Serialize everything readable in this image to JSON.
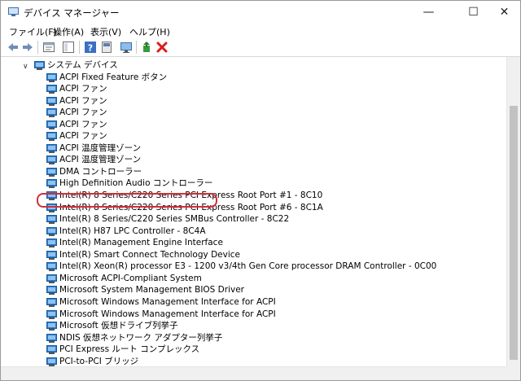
{
  "window": {
    "title": "デバイス マネージャー",
    "minimize_glyph": "—",
    "maximize_glyph": "☐",
    "close_glyph": "✕"
  },
  "menu": [
    {
      "label": "ファイル(F)"
    },
    {
      "label": "操作(A)"
    },
    {
      "label": "表示(V)"
    },
    {
      "label": "ヘルプ(H)"
    }
  ],
  "toolbar_icons": [
    "back-arrow-icon",
    "forward-arrow-icon",
    "properties-icon",
    "show-hide-console-tree-icon",
    "help-icon",
    "help-book-icon",
    "monitor-icon",
    "add-driver-icon",
    "uninstall-x-icon"
  ],
  "tree": {
    "category_label": "システム デバイス",
    "expanded": true,
    "items": [
      {
        "label": "ACPI Fixed Feature ボタン"
      },
      {
        "label": "ACPI ファン"
      },
      {
        "label": "ACPI ファン"
      },
      {
        "label": "ACPI ファン"
      },
      {
        "label": "ACPI ファン"
      },
      {
        "label": "ACPI ファン"
      },
      {
        "label": "ACPI 温度管理ゾーン"
      },
      {
        "label": "ACPI 温度管理ゾーン"
      },
      {
        "label": "DMA コントローラー"
      },
      {
        "label": "High Definition Audio コントローラー"
      },
      {
        "label": "Intel(R) 8 Series/C220 Series PCI Express Root Port #1 - 8C10"
      },
      {
        "label": "Intel(R) 8 Series/C220 Series PCI Express Root Port #6 - 8C1A"
      },
      {
        "label": "Intel(R) 8 Series/C220 Series SMBus Controller - 8C22"
      },
      {
        "label": "Intel(R) H87 LPC Controller - 8C4A"
      },
      {
        "label": "Intel(R) Management Engine Interface"
      },
      {
        "label": "Intel(R) Smart Connect Technology Device",
        "highlighted": true
      },
      {
        "label": "Intel(R) Xeon(R) processor E3 - 1200 v3/4th Gen Core processor DRAM Controller - 0C00"
      },
      {
        "label": "Microsoft ACPI-Compliant System"
      },
      {
        "label": "Microsoft System Management BIOS Driver"
      },
      {
        "label": "Microsoft Windows Management Interface for ACPI"
      },
      {
        "label": "Microsoft Windows Management Interface for ACPI"
      },
      {
        "label": "Microsoft 仮想ドライブ列挙子"
      },
      {
        "label": "NDIS 仮想ネットワーク アダプター列挙子"
      },
      {
        "label": "PCI Express ルート コンプレックス"
      },
      {
        "label": "PCI-to-PCI ブリッジ"
      }
    ]
  },
  "colors": {
    "highlight_border": "#cf2f3b",
    "device_icon_blue": "#2b7fd0",
    "uninstall_red": "#d81e1e"
  }
}
